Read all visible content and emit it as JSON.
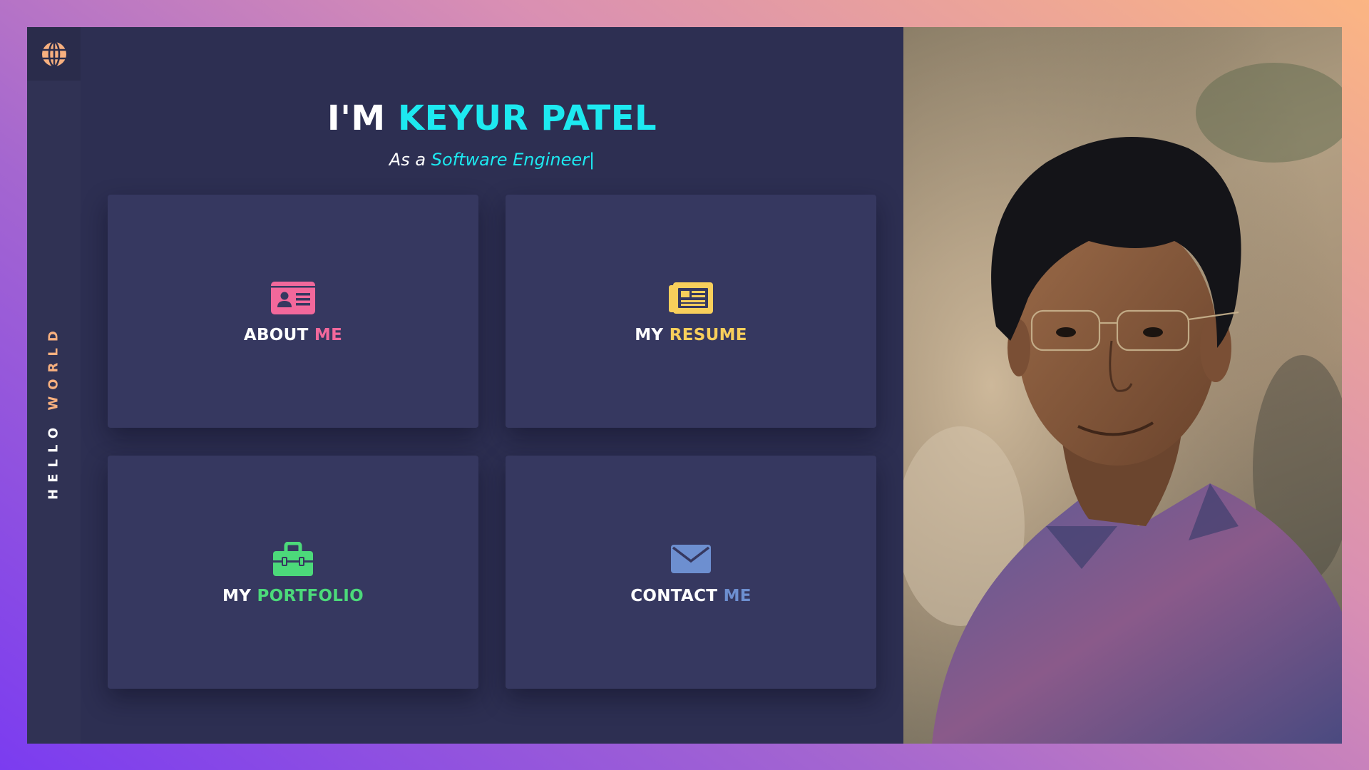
{
  "sidebar": {
    "logo_icon": "globe-icon",
    "vertical_text_part1": "HELLO",
    "vertical_text_part2": "WORLD"
  },
  "hero": {
    "title_prefix": "I'M",
    "title_name": "KEYUR PATEL",
    "subtitle_prefix": "As a",
    "subtitle_role": "Software Engineer|"
  },
  "cards": [
    {
      "icon": "id-card-icon",
      "label_main": "ABOUT",
      "label_accent": "ME",
      "accent_color": "#f2689b"
    },
    {
      "icon": "newspaper-icon",
      "label_main": "MY",
      "label_accent": "RESUME",
      "accent_color": "#f8cf5b"
    },
    {
      "icon": "toolbox-icon",
      "label_main": "MY",
      "label_accent": "PORTFOLIO",
      "accent_color": "#4cd97a"
    },
    {
      "icon": "envelope-icon",
      "label_main": "CONTACT",
      "label_accent": "ME",
      "accent_color": "#6d8fd0"
    }
  ],
  "colors": {
    "panel_bg": "#2d2f52",
    "card_bg": "#363860",
    "cyan_accent": "#1de9f0",
    "side_accent": "#f7b07f"
  }
}
